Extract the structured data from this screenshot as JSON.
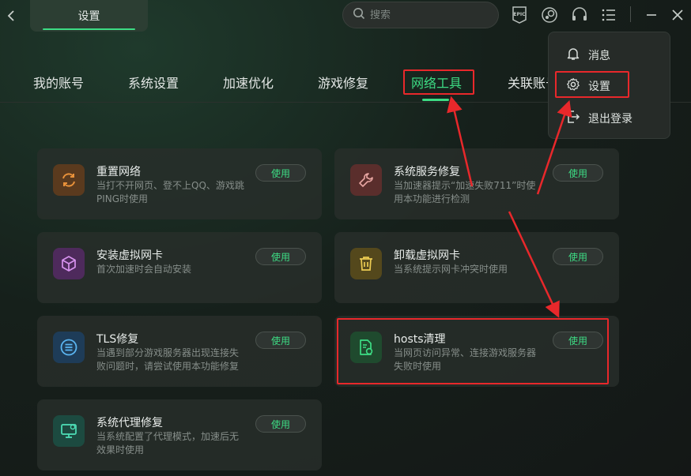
{
  "header": {
    "back_icon": "chevron-left-icon",
    "title": "设置",
    "search_placeholder": "搜索",
    "icons": [
      "epic-games-icon",
      "steam-icon",
      "headset-icon",
      "menu-list-icon",
      "minimize-icon",
      "close-icon"
    ]
  },
  "tabs": [
    {
      "label": "我的账号"
    },
    {
      "label": "系统设置"
    },
    {
      "label": "加速优化"
    },
    {
      "label": "游戏修复"
    },
    {
      "label": "网络工具"
    },
    {
      "label": "关联账号"
    }
  ],
  "active_tab": "网络工具",
  "tools": [
    {
      "name": "重置网络",
      "desc": "当打不开网页、登不上QQ、游戏跳PING时使用",
      "button": "使用",
      "icon": "refresh-icon",
      "color": "#e8913a"
    },
    {
      "name": "系统服务修复",
      "desc": "当加速器提示“加速失败711”时使用本功能进行检测",
      "button": "使用",
      "icon": "wrench-icon",
      "color": "#e0706a"
    },
    {
      "name": "安装虚拟网卡",
      "desc": "首次加速时会自动安装",
      "button": "使用",
      "icon": "cube-icon",
      "color": "#c77de0"
    },
    {
      "name": "卸载虚拟网卡",
      "desc": "当系统提示网卡冲突时使用",
      "button": "使用",
      "icon": "trash-icon",
      "color": "#e2c24a"
    },
    {
      "name": "TLS修复",
      "desc": "当遇到部分游戏服务器出现连接失败问题时，请尝试使用本功能修复",
      "button": "使用",
      "icon": "tls-list-icon",
      "color": "#4aa6e8"
    },
    {
      "name": "hosts清理",
      "desc": "当网页访问异常、连接游戏服务器失败时使用",
      "button": "使用",
      "icon": "file-refresh-icon",
      "color": "#3ddc84"
    },
    {
      "name": "系统代理修复",
      "desc": "当系统配置了代理模式，加速后无效果时使用",
      "button": "使用",
      "icon": "monitor-refresh-icon",
      "color": "#3ddcb0"
    }
  ],
  "menu": {
    "items": [
      {
        "label": "消息",
        "icon": "bell-icon"
      },
      {
        "label": "设置",
        "icon": "gear-icon"
      },
      {
        "label": "退出登录",
        "icon": "logout-icon"
      }
    ]
  },
  "colors": {
    "accent": "#3ddc84",
    "annotation": "#e8282b"
  }
}
